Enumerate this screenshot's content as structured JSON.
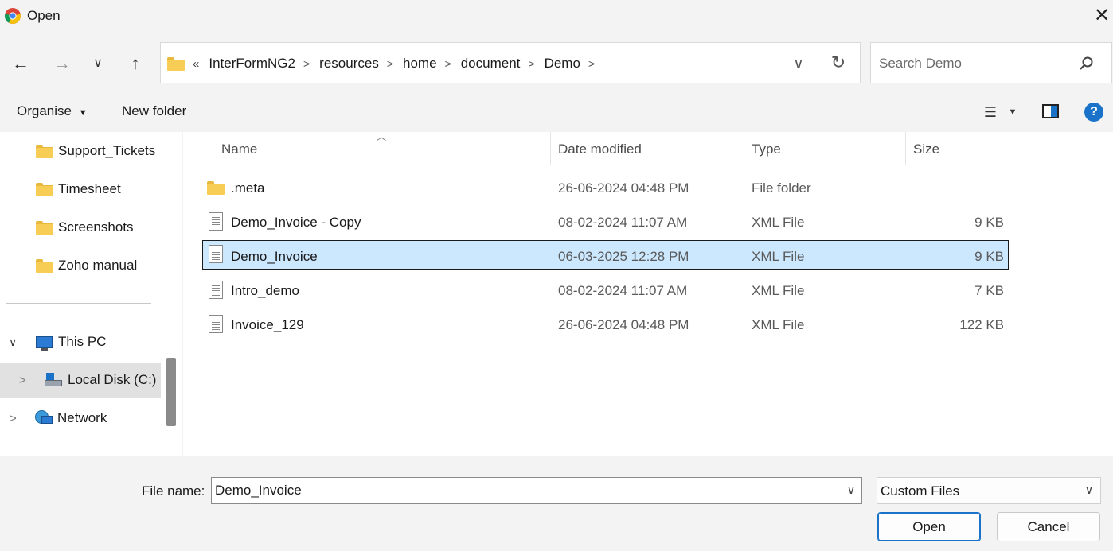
{
  "window": {
    "title": "Open",
    "close_icon": "close-icon"
  },
  "nav": {
    "back_icon": "arrow-left-icon",
    "forward_icon": "arrow-right-icon",
    "recent_icon": "chevron-down-icon",
    "up_icon": "arrow-up-icon"
  },
  "address": {
    "overflow": "«",
    "crumbs": [
      "InterFormNG2",
      "resources",
      "home",
      "document",
      "Demo"
    ]
  },
  "search": {
    "placeholder": "Search Demo"
  },
  "toolbar": {
    "organise": "Organise",
    "new_folder": "New folder"
  },
  "sidebar": {
    "folders": [
      "Support_Tickets",
      "Timesheet",
      "Screenshots",
      "Zoho manual"
    ],
    "this_pc": "This PC",
    "local_disk": "Local Disk (C:)",
    "network": "Network"
  },
  "columns": {
    "name": "Name",
    "date": "Date modified",
    "type": "Type",
    "size": "Size"
  },
  "files": [
    {
      "name": ".meta",
      "date": "26-06-2024 04:48 PM",
      "type": "File folder",
      "size": "",
      "icon": "folder-icon"
    },
    {
      "name": "Demo_Invoice - Copy",
      "date": "08-02-2024 11:07 AM",
      "type": "XML File",
      "size": "9 KB",
      "icon": "document-icon"
    },
    {
      "name": "Demo_Invoice",
      "date": "06-03-2025 12:28 PM",
      "type": "XML File",
      "size": "9 KB",
      "icon": "document-icon",
      "selected": true
    },
    {
      "name": "Intro_demo",
      "date": "08-02-2024 11:07 AM",
      "type": "XML File",
      "size": "7 KB",
      "icon": "document-icon"
    },
    {
      "name": "Invoice_129",
      "date": "26-06-2024 04:48 PM",
      "type": "XML File",
      "size": "122 KB",
      "icon": "document-icon"
    }
  ],
  "footer": {
    "file_name_label": "File name:",
    "file_name_value": "Demo_Invoice",
    "filter_value": "Custom Files",
    "open_label": "Open",
    "cancel_label": "Cancel"
  },
  "colors": {
    "accent": "#1a73c9",
    "selection": "#cce8ff",
    "folder": "#f7cd55"
  }
}
